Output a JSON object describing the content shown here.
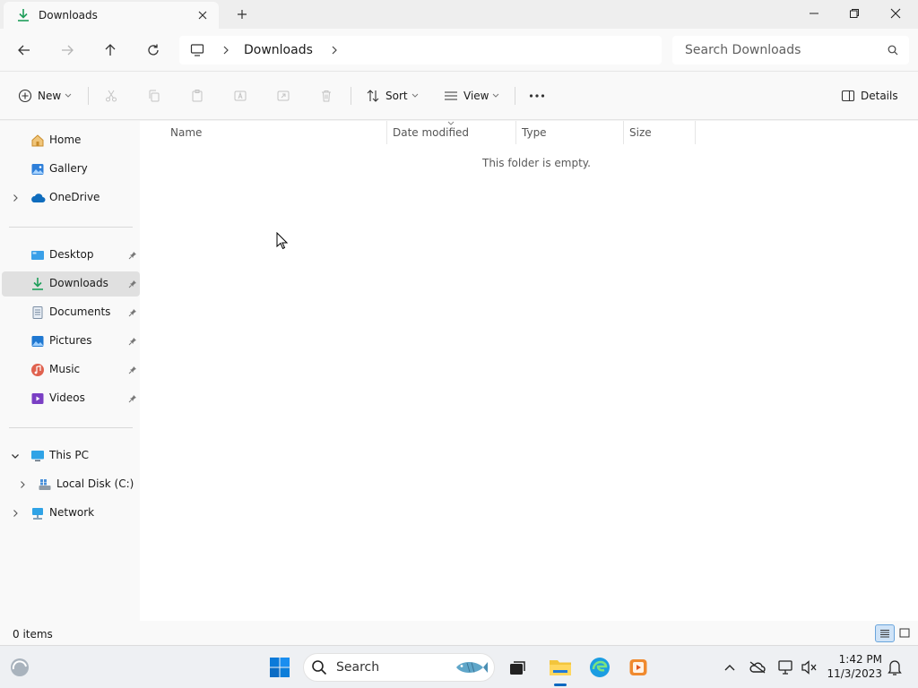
{
  "tab": {
    "title": "Downloads"
  },
  "address": {
    "crumbs": [
      "Downloads"
    ]
  },
  "search": {
    "placeholder": "Search Downloads"
  },
  "commands": {
    "new": "New",
    "sort": "Sort",
    "view": "View",
    "details": "Details"
  },
  "sidebar": {
    "quick": [
      {
        "label": "Home"
      },
      {
        "label": "Gallery"
      },
      {
        "label": "OneDrive"
      }
    ],
    "pinned": [
      {
        "label": "Desktop"
      },
      {
        "label": "Downloads"
      },
      {
        "label": "Documents"
      },
      {
        "label": "Pictures"
      },
      {
        "label": "Music"
      },
      {
        "label": "Videos"
      }
    ],
    "devices": [
      {
        "label": "This PC"
      },
      {
        "label": "Local Disk (C:)"
      },
      {
        "label": "Network"
      }
    ]
  },
  "columns": [
    "Name",
    "Date modified",
    "Type",
    "Size"
  ],
  "content": {
    "empty_message": "This folder is empty."
  },
  "status": {
    "item_count": "0 items"
  },
  "taskbar": {
    "search_label": "Search",
    "time": "1:42 PM",
    "date": "11/3/2023"
  },
  "colors": {
    "accent": "#0067c0",
    "download_green": "#1e9e5a",
    "folder_yellow": "#f3c53c"
  }
}
